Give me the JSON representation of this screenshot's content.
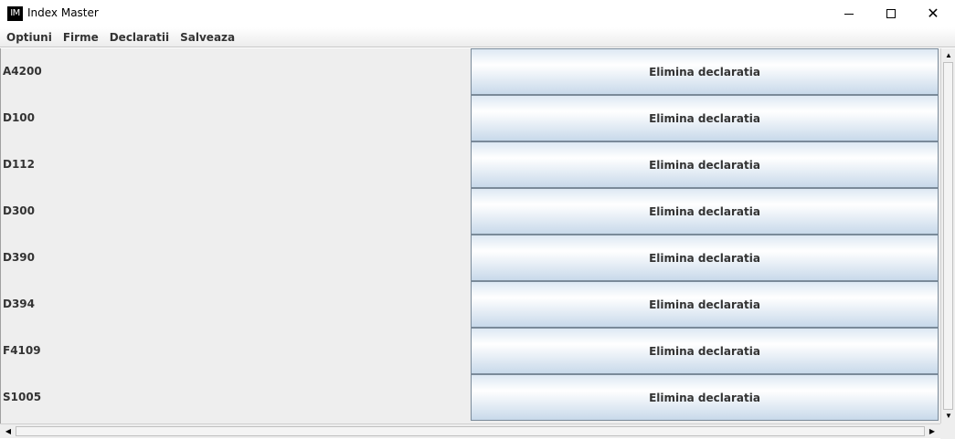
{
  "window": {
    "logo_text": "IM",
    "title": "Index Master",
    "minimize_icon": "minimize-icon",
    "maximize_icon": "maximize-icon",
    "close_icon": "close-icon"
  },
  "menu": {
    "items": [
      "Optiuni",
      "Firme",
      "Declaratii",
      "Salveaza"
    ]
  },
  "declarations": [
    {
      "code": "A4200",
      "button": "Elimina declaratia"
    },
    {
      "code": "D100",
      "button": "Elimina declaratia"
    },
    {
      "code": "D112",
      "button": "Elimina declaratia"
    },
    {
      "code": "D300",
      "button": "Elimina declaratia"
    },
    {
      "code": "D390",
      "button": "Elimina declaratia"
    },
    {
      "code": "D394",
      "button": "Elimina declaratia"
    },
    {
      "code": "F4109",
      "button": "Elimina declaratia"
    },
    {
      "code": "S1005",
      "button": "Elimina declaratia"
    }
  ],
  "scrollbars": {
    "up_arrow": "▲",
    "down_arrow": "▼",
    "left_arrow": "◀",
    "right_arrow": "▶"
  },
  "colors": {
    "button_border": "#7a8a99",
    "button_gradient_top": "#dde8f3",
    "button_gradient_bottom": "#c8d9ea",
    "content_background": "#eeeeee"
  }
}
